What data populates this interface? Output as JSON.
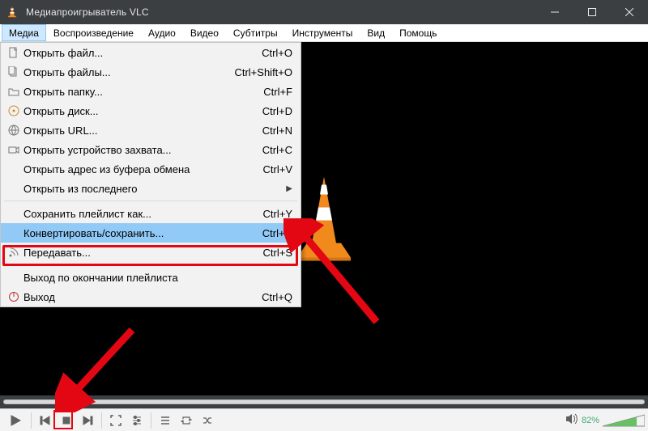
{
  "window": {
    "title": "Медиапроигрыватель VLC"
  },
  "menubar": {
    "items": [
      {
        "label": "Медиа",
        "open": true
      },
      {
        "label": "Воспроизведение",
        "open": false
      },
      {
        "label": "Аудио",
        "open": false
      },
      {
        "label": "Видео",
        "open": false
      },
      {
        "label": "Субтитры",
        "open": false
      },
      {
        "label": "Инструменты",
        "open": false
      },
      {
        "label": "Вид",
        "open": false
      },
      {
        "label": "Помощь",
        "open": false
      }
    ]
  },
  "dropdown": {
    "items": [
      {
        "type": "item",
        "icon": "file",
        "label": "Открыть файл...",
        "shortcut": "Ctrl+O"
      },
      {
        "type": "item",
        "icon": "files",
        "label": "Открыть файлы...",
        "shortcut": "Ctrl+Shift+O"
      },
      {
        "type": "item",
        "icon": "folder",
        "label": "Открыть папку...",
        "shortcut": "Ctrl+F"
      },
      {
        "type": "item",
        "icon": "disc",
        "label": "Открыть диск...",
        "shortcut": "Ctrl+D"
      },
      {
        "type": "item",
        "icon": "network",
        "label": "Открыть URL...",
        "shortcut": "Ctrl+N"
      },
      {
        "type": "item",
        "icon": "capture",
        "label": "Открыть устройство захвата...",
        "shortcut": "Ctrl+C"
      },
      {
        "type": "item",
        "icon": "",
        "label": "Открыть адрес из буфера обмена",
        "shortcut": "Ctrl+V"
      },
      {
        "type": "sub",
        "icon": "",
        "label": "Открыть из последнего"
      },
      {
        "type": "sep"
      },
      {
        "type": "item",
        "icon": "",
        "label": "Сохранить плейлист как...",
        "shortcut": "Ctrl+Y"
      },
      {
        "type": "item",
        "icon": "",
        "label": "Конвертировать/сохранить...",
        "shortcut": "Ctrl+R",
        "highlighted": true
      },
      {
        "type": "item",
        "icon": "stream",
        "label": "Передавать...",
        "shortcut": "Ctrl+S"
      },
      {
        "type": "sep"
      },
      {
        "type": "item",
        "icon": "",
        "label": "Выход по окончании плейлиста",
        "shortcut": ""
      },
      {
        "type": "item",
        "icon": "quit",
        "label": "Выход",
        "shortcut": "Ctrl+Q"
      }
    ]
  },
  "controls": {
    "volume_percent": "82%"
  }
}
